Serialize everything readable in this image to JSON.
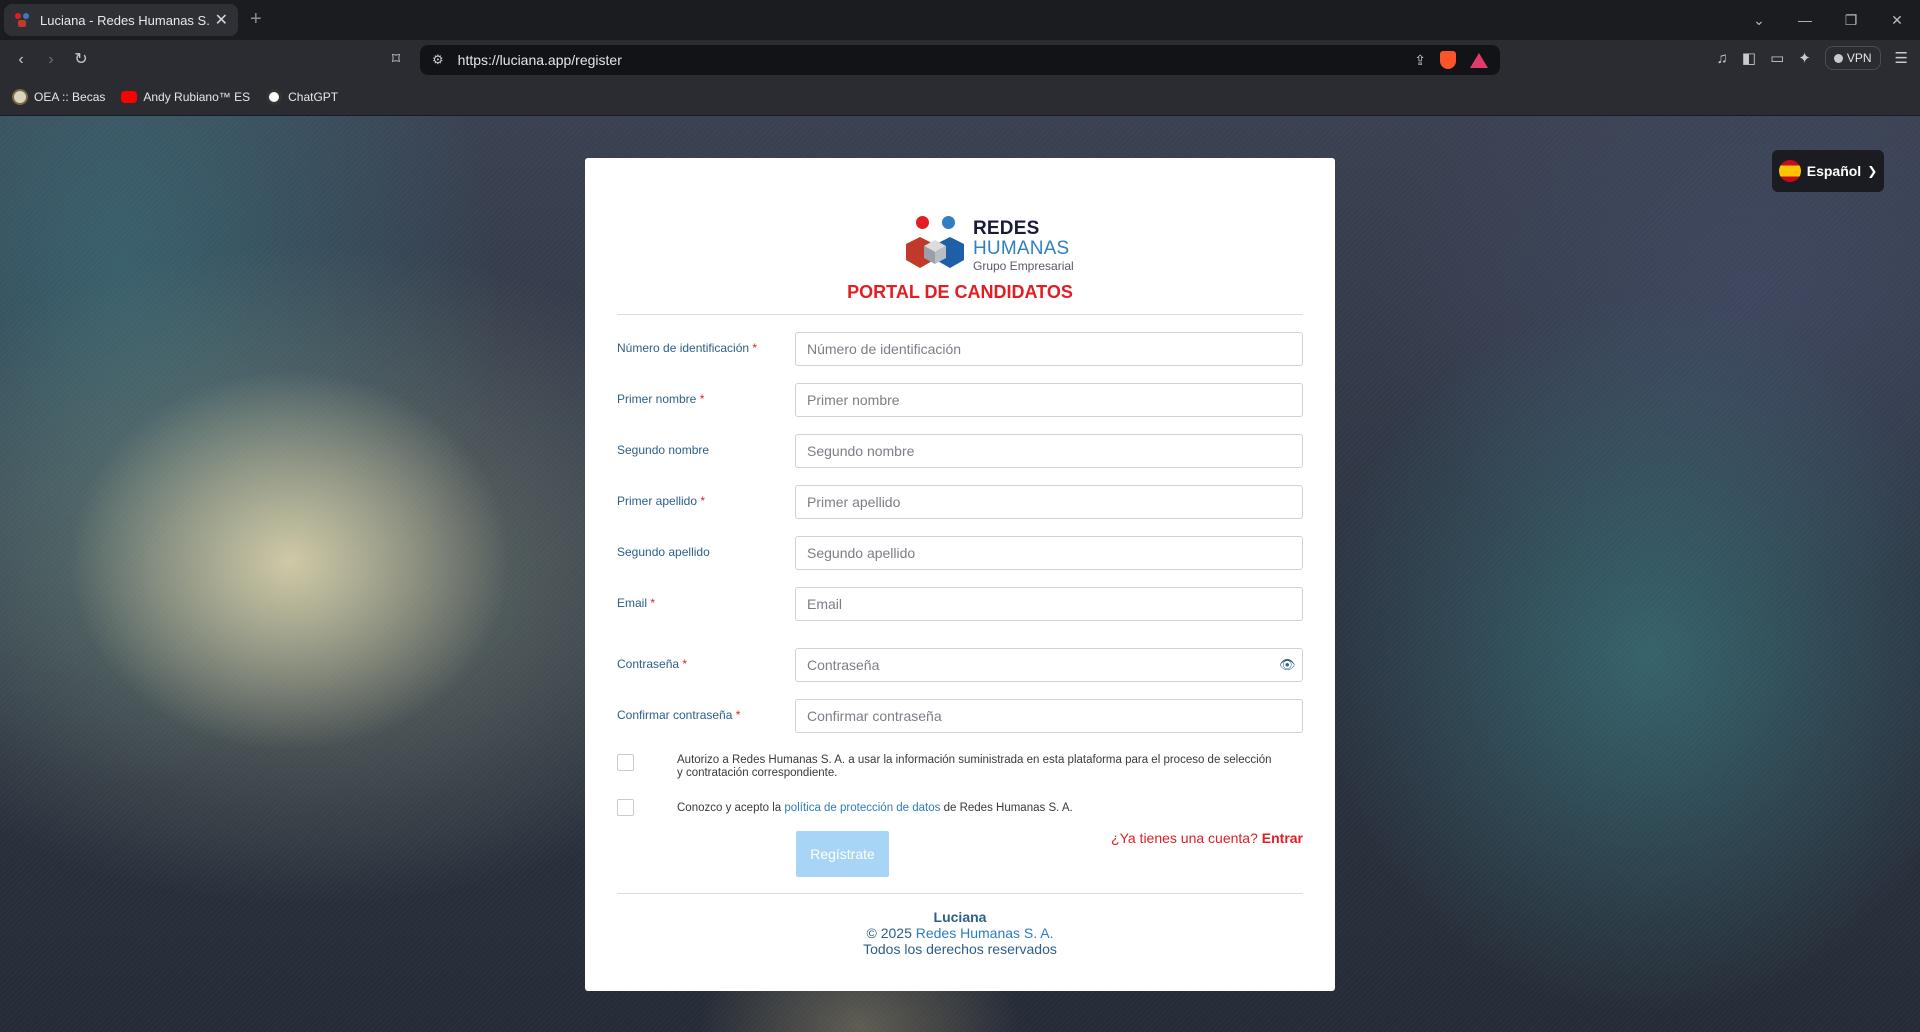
{
  "browser": {
    "tab_title": "Luciana - Redes Humanas S. A.",
    "tab_close": "✕",
    "new_tab": "+",
    "url": "https://luciana.app/register",
    "vpn_label": "VPN",
    "bookmarks": [
      {
        "label": "OEA :: Becas",
        "icon": "oea-icon"
      },
      {
        "label": "Andy Rubiano™ ES",
        "icon": "youtube-icon"
      },
      {
        "label": "ChatGPT",
        "icon": "chatgpt-icon"
      }
    ]
  },
  "language": {
    "label": "Español",
    "flag": "spain-flag"
  },
  "brand": {
    "word1": "REDES",
    "word2": "HUMANAS",
    "word3": "Grupo Empresarial",
    "portal_title": "PORTAL DE CANDIDATOS",
    "colors": {
      "red": "#e21d24",
      "blue": "#2f7fc1",
      "navy": "#1a1a3a"
    }
  },
  "form": {
    "required_mark": "*",
    "fields": [
      {
        "label": "Número de identificación",
        "placeholder": "Número de identificación",
        "required": true
      },
      {
        "label": "Primer nombre",
        "placeholder": "Primer nombre",
        "required": true
      },
      {
        "label": "Segundo nombre",
        "placeholder": "Segundo nombre",
        "required": false
      },
      {
        "label": "Primer apellido",
        "placeholder": "Primer apellido",
        "required": true
      },
      {
        "label": "Segundo apellido",
        "placeholder": "Segundo apellido",
        "required": false
      },
      {
        "label": "Email",
        "placeholder": "Email",
        "required": true
      },
      {
        "label": "Contraseña",
        "placeholder": "Contraseña",
        "required": true
      },
      {
        "label": "Confirmar contraseña",
        "placeholder": "Confirmar contraseña",
        "required": true
      }
    ],
    "consent_text": "Autorizo a Redes Humanas S. A. a usar la información suministrada en esta plataforma para el proceso de selección y contratación correspondiente.",
    "policy_prefix": "Conozco y acepto la ",
    "policy_link": "política de protección de datos",
    "policy_suffix": " de Redes Humanas S. A.",
    "register_label": "Regístrate",
    "have_account_text": "¿Ya tienes una cuenta? ",
    "login_link": "Entrar"
  },
  "footer": {
    "app_name": "Luciana",
    "copyright_prefix": "© 2025 ",
    "company": "Redes Humanas S. A.",
    "rights": "Todos los derechos reservados"
  }
}
